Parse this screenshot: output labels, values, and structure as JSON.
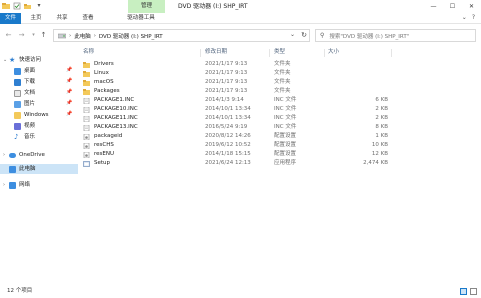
{
  "titlebar": {
    "manage_tab": "管理",
    "title": "DVD 驱动器 (I:) SHP_IRT",
    "min": "—",
    "max": "☐",
    "close": "✕"
  },
  "ribbon": {
    "tabs": [
      "文件",
      "主页",
      "共享",
      "查看",
      "驱动器工具"
    ],
    "expand": "⌄",
    "help": "?"
  },
  "address": {
    "crumbs": [
      "此电脑",
      "DVD 驱动器 (I:) SHP_IRT"
    ],
    "separator": "›",
    "search_placeholder": "搜索\"DVD 驱动器 (I:) SHP_IRT\""
  },
  "sidebar": {
    "quick_access": "快速访问",
    "items": [
      {
        "label": "桌面",
        "icon": "desktop-icon",
        "pinned": true
      },
      {
        "label": "下载",
        "icon": "download-icon",
        "pinned": true
      },
      {
        "label": "文档",
        "icon": "documents-icon",
        "pinned": true
      },
      {
        "label": "图片",
        "icon": "pictures-icon",
        "pinned": true
      },
      {
        "label": "Windows",
        "icon": "folder-icon",
        "pinned": true
      },
      {
        "label": "视频",
        "icon": "videos-icon",
        "pinned": false
      },
      {
        "label": "音乐",
        "icon": "music-icon",
        "pinned": false
      }
    ],
    "onedrive": "OneDrive",
    "this_pc": "此电脑",
    "network": "网络"
  },
  "table": {
    "columns": {
      "name": "名称",
      "date": "修改日期",
      "type": "类型",
      "size": "大小"
    },
    "rows": [
      {
        "name": "Drivers",
        "date": "2021/1/17 9:13",
        "type": "文件夹",
        "size": "",
        "icon": "folder"
      },
      {
        "name": "Linux",
        "date": "2021/1/17 9:13",
        "type": "文件夹",
        "size": "",
        "icon": "folder"
      },
      {
        "name": "macOS",
        "date": "2021/1/17 9:13",
        "type": "文件夹",
        "size": "",
        "icon": "folder"
      },
      {
        "name": "Packages",
        "date": "2021/1/17 9:13",
        "type": "文件夹",
        "size": "",
        "icon": "folder"
      },
      {
        "name": "PACKAGE1.INC",
        "date": "2014/1/3 9:14",
        "type": "INC 文件",
        "size": "6 KB",
        "icon": "file"
      },
      {
        "name": "PACKAGE10.INC",
        "date": "2014/10/1 13:34",
        "type": "INC 文件",
        "size": "2 KB",
        "icon": "file"
      },
      {
        "name": "PACKAGE11.INC",
        "date": "2014/10/1 13:34",
        "type": "INC 文件",
        "size": "2 KB",
        "icon": "file"
      },
      {
        "name": "PACKAGE13.INC",
        "date": "2016/5/24 9:19",
        "type": "INC 文件",
        "size": "8 KB",
        "icon": "file"
      },
      {
        "name": "packageid",
        "date": "2020/8/12 14:26",
        "type": "配置设置",
        "size": "1 KB",
        "icon": "config"
      },
      {
        "name": "resCHS",
        "date": "2019/6/12 10:52",
        "type": "配置设置",
        "size": "10 KB",
        "icon": "config"
      },
      {
        "name": "resENU",
        "date": "2014/1/18 15:15",
        "type": "配置设置",
        "size": "12 KB",
        "icon": "config"
      },
      {
        "name": "Setup",
        "date": "2021/6/24 12:13",
        "type": "应用程序",
        "size": "2,474 KB",
        "icon": "app"
      }
    ]
  },
  "status": {
    "count": "12 个项目"
  },
  "colors": {
    "accent": "#1979ca",
    "manage_tab_bg": "#c8efc1",
    "folder": "#f3c95a",
    "selected": "#cce4f7"
  }
}
